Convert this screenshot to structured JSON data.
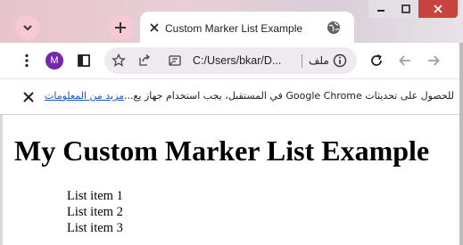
{
  "browser": {
    "tab": {
      "title": "Custom Marker List Example"
    },
    "avatar_letter": "M",
    "omnibox": {
      "url": "C:/Users/bkar/D...",
      "scheme_label": "ملف"
    },
    "infobar": {
      "message": "للحصول على تحديثات Google Chrome في المستقبل، يجب استخدام جهاز يع...",
      "link": "مزيد من المعلومات"
    }
  },
  "page": {
    "heading": "My Custom Marker List Example",
    "list_items": [
      "List item 1",
      "List item 2",
      "List item 3"
    ]
  },
  "colors": {
    "frame_pink": "#e9cfd6",
    "avatar_purple": "#7627b1",
    "close_red": "#c7433c",
    "link_blue": "#1a57c8"
  },
  "icons": [
    "chevron-down-icon",
    "plus-icon",
    "close-icon",
    "globe-icon",
    "minimize-icon",
    "maximize-icon",
    "window-close-icon",
    "more-vert-icon",
    "side-panel-icon",
    "star-icon",
    "share-icon",
    "extension-icon",
    "info-icon",
    "reload-icon",
    "back-arrow-icon",
    "forward-arrow-icon"
  ]
}
